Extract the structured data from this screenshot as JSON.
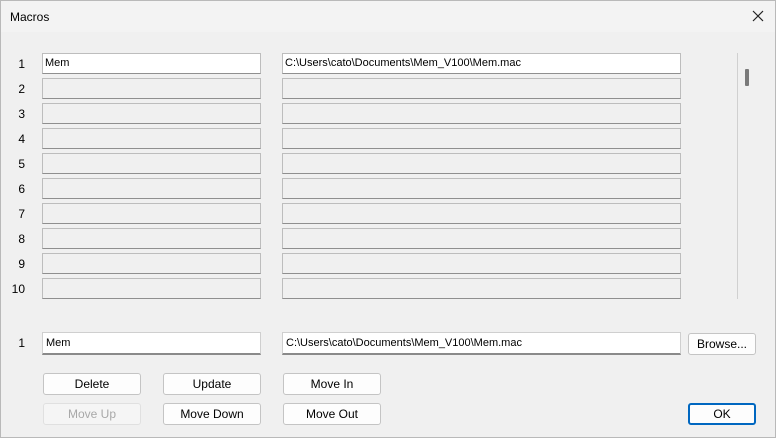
{
  "window": {
    "title": "Macros",
    "close_glyph": "close-icon"
  },
  "macro_list": {
    "rows": [
      {
        "num": "1",
        "name": "Mem",
        "path": "C:\\Users\\cato\\Documents\\Mem_V100\\Mem.mac"
      },
      {
        "num": "2",
        "name": "",
        "path": ""
      },
      {
        "num": "3",
        "name": "",
        "path": ""
      },
      {
        "num": "4",
        "name": "",
        "path": ""
      },
      {
        "num": "5",
        "name": "",
        "path": ""
      },
      {
        "num": "6",
        "name": "",
        "path": ""
      },
      {
        "num": "7",
        "name": "",
        "path": ""
      },
      {
        "num": "8",
        "name": "",
        "path": ""
      },
      {
        "num": "9",
        "name": "",
        "path": ""
      },
      {
        "num": "10",
        "name": "",
        "path": ""
      }
    ]
  },
  "editor": {
    "num": "1",
    "name": "Mem",
    "path": "C:\\Users\\cato\\Documents\\Mem_V100\\Mem.mac",
    "browse_label": "Browse..."
  },
  "buttons": {
    "delete": "Delete",
    "update": "Update",
    "move_in": "Move In",
    "move_up": "Move Up",
    "move_down": "Move Down",
    "move_out": "Move Out",
    "ok": "OK"
  },
  "colors": {
    "accent": "#0067c0",
    "background": "#f0f0f0"
  }
}
